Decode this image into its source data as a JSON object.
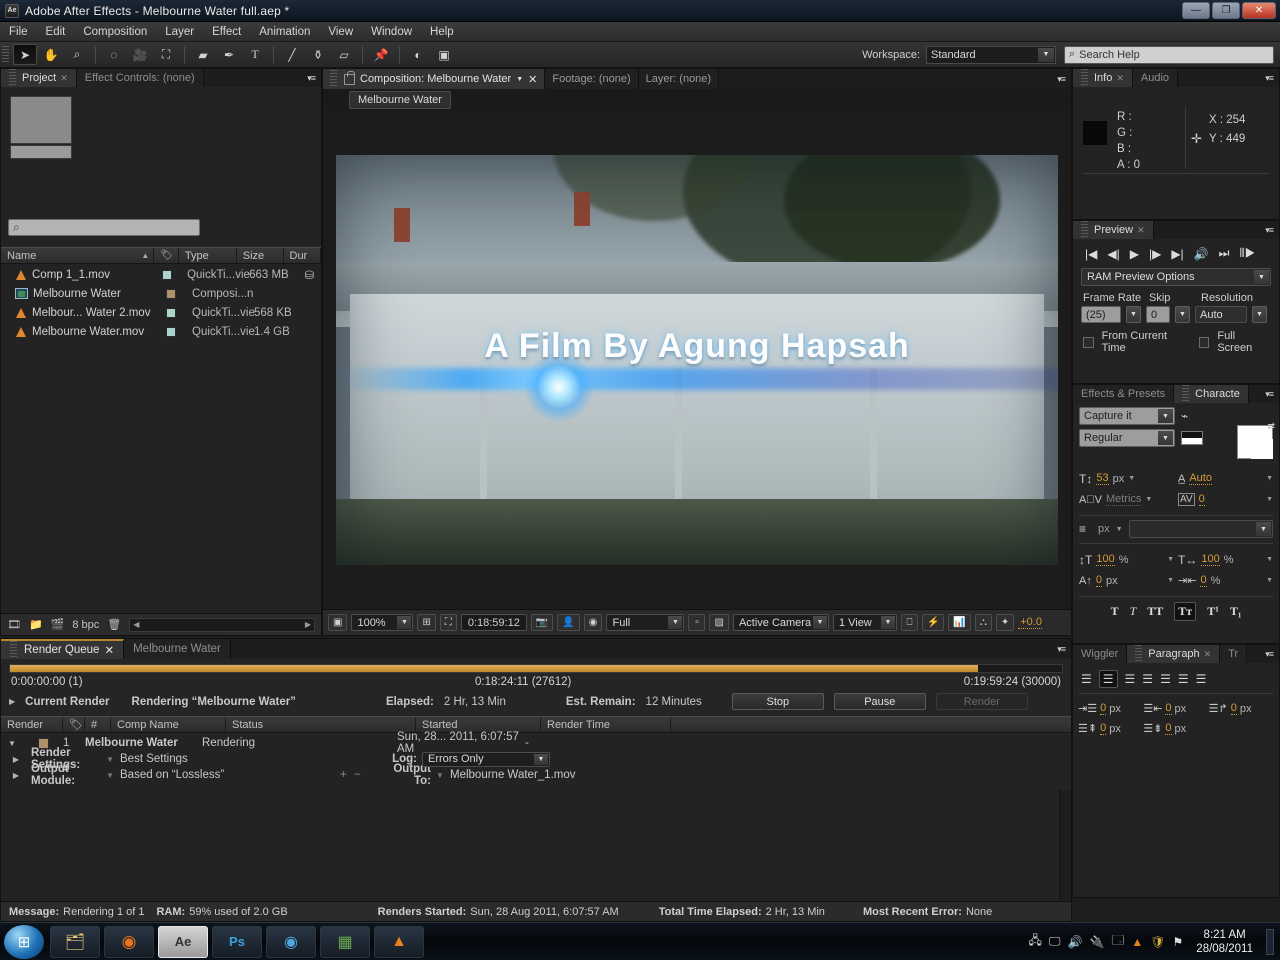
{
  "window": {
    "title": "Adobe After Effects - Melbourne Water full.aep *",
    "app_badge": "Ae",
    "minimize": "—",
    "maximize": "❐",
    "close": "✕"
  },
  "menubar": [
    "File",
    "Edit",
    "Composition",
    "Layer",
    "Effect",
    "Animation",
    "View",
    "Window",
    "Help"
  ],
  "toolbar": {
    "tools": [
      {
        "name": "selection-tool",
        "glyph": "➤"
      },
      {
        "name": "hand-tool",
        "glyph": "✋"
      },
      {
        "name": "zoom-tool",
        "glyph": "🔍"
      },
      {
        "name": "rotation-tool",
        "glyph": "⟳"
      },
      {
        "name": "camera-tool",
        "glyph": "🎥"
      },
      {
        "name": "anchor-point-tool",
        "glyph": "⛶"
      },
      {
        "name": "shape-tool",
        "glyph": "▢"
      },
      {
        "name": "pen-tool",
        "glyph": "✒"
      },
      {
        "name": "type-tool",
        "glyph": "T"
      },
      {
        "name": "brush-tool",
        "glyph": "🖌"
      },
      {
        "name": "clone-stamp-tool",
        "glyph": "⚒"
      },
      {
        "name": "eraser-tool",
        "glyph": "▱"
      },
      {
        "name": "puppet-pin-tool",
        "glyph": "📌"
      },
      {
        "name": "roto-brush-tool",
        "glyph": "◐"
      },
      {
        "name": "mask-tool",
        "glyph": "▣"
      }
    ],
    "workspace_label": "Workspace:",
    "workspace_value": "Standard",
    "search_placeholder": "Search Help",
    "search_icon": "search-icon"
  },
  "project_panel": {
    "tabs": [
      {
        "label": "Project",
        "active": true,
        "closable": true
      },
      {
        "label": "Effect Controls: (none)",
        "active": false,
        "closable": false
      }
    ],
    "search_placeholder": "",
    "search_icon": "search-icon",
    "columns": [
      "Name",
      "",
      "Type",
      "Size",
      "Dur"
    ],
    "items": [
      {
        "name": "Comp 1_1.mov",
        "icon": "movie-cone-icon",
        "label_color": "#a8d4cc",
        "type": "QuickTi...vie",
        "size": "663 MB"
      },
      {
        "name": "Melbourne Water",
        "icon": "composition-icon",
        "label_color": "#b09068",
        "type": "Composi...n",
        "size": ""
      },
      {
        "name": "Melbour... Water 2.mov",
        "icon": "movie-cone-icon",
        "label_color": "#a8d4cc",
        "type": "QuickTi...vie",
        "size": "568 KB"
      },
      {
        "name": "Melbourne Water.mov",
        "icon": "movie-cone-icon",
        "label_color": "#a8d4cc",
        "type": "QuickTi...vie",
        "size": "1.4 GB"
      }
    ],
    "footer": {
      "bit_depth": "8 bpc",
      "icons": [
        "new-comp-icon",
        "new-folder-icon",
        "interpret-footage-icon",
        "delete-icon"
      ]
    }
  },
  "comp_panel": {
    "tabs": [
      {
        "label": "Composition: Melbourne Water",
        "active": true
      },
      {
        "label": "Footage: (none)",
        "active": false
      },
      {
        "label": "Layer: (none)",
        "active": false
      }
    ],
    "comp_name_chip": "Melbourne Water",
    "viewer_title_line1": "A Film By Agung Hapsah",
    "footer": {
      "zoom": "100%",
      "time": "0:18:59:12",
      "resolution": "Full",
      "camera": "Active Camera",
      "views": "1 View",
      "exposure": "+0.0"
    }
  },
  "info_panel": {
    "tabs": [
      {
        "label": "Info",
        "active": true
      },
      {
        "label": "Audio",
        "active": false
      }
    ],
    "r": "R :",
    "g": "G :",
    "b": "B :",
    "a": "A : 0",
    "x": "X : 254",
    "y": "Y : 449"
  },
  "preview_panel": {
    "tabs": [
      {
        "label": "Preview",
        "active": true
      }
    ],
    "transport": [
      "first-frame-icon",
      "prev-frame-icon",
      "play-icon",
      "next-frame-icon",
      "last-frame-icon",
      "audio-icon",
      "ram-preview-icon",
      "loop-icon"
    ],
    "options_label": "RAM Preview Options",
    "frame_rate_label": "Frame Rate",
    "frame_rate_value": "(25)",
    "skip_label": "Skip",
    "skip_value": "0",
    "resolution_label": "Resolution",
    "resolution_value": "Auto",
    "from_current_time": "From Current Time",
    "full_screen": "Full Screen"
  },
  "character_panel": {
    "tabs": [
      {
        "label": "Effects & Presets",
        "active": false
      },
      {
        "label": "Characte",
        "active": true
      }
    ],
    "font_family": "Capture it",
    "font_style": "Regular",
    "font_size": "53",
    "font_size_unit": "px",
    "leading": "Auto",
    "kerning": "Metrics",
    "tracking": "0",
    "stroke_width": "",
    "stroke_width_unit": "px",
    "vertical_scale": "100",
    "horizontal_scale": "100",
    "baseline_shift": "0",
    "baseline_unit": "px",
    "tsume": "0",
    "tsume_unit": "%",
    "percent": "%",
    "style_buttons": [
      "T",
      "T",
      "TT",
      "Tᴛ",
      "T¹",
      "T₁"
    ]
  },
  "paragraph_panel": {
    "tabs": [
      {
        "label": "Wiggler",
        "active": false
      },
      {
        "label": "Paragraph",
        "active": true
      },
      {
        "label": "Tr",
        "active": false
      }
    ],
    "indents": [
      "0",
      "0",
      "0",
      "0",
      "0"
    ],
    "unit": "px"
  },
  "render_queue": {
    "tabs": [
      {
        "label": "Render Queue",
        "active": true,
        "closable": true
      },
      {
        "label": "Melbourne Water",
        "active": false,
        "closable": false
      }
    ],
    "progress_percent": 92,
    "time_start": "0:00:00:00 (1)",
    "time_current": "0:18:24:11 (27612)",
    "time_end": "0:19:59:24 (30000)",
    "current_render_label": "Current Render",
    "current_render_value": "Rendering “Melbourne Water”",
    "elapsed_label": "Elapsed:",
    "elapsed_value": "2 Hr, 13 Min",
    "est_remain_label": "Est. Remain:",
    "est_remain_value": "12 Minutes",
    "stop_button": "Stop",
    "pause_button": "Pause",
    "render_button": "Render",
    "columns": [
      "Render",
      "",
      "#",
      "Comp Name",
      "Status",
      "Started",
      "Render Time"
    ],
    "row": {
      "number": "1",
      "comp_name": "Melbourne Water",
      "status": "Rendering",
      "started": "Sun, 28... 2011, 6:07:57 AM",
      "render_time": "-"
    },
    "render_settings_label": "Render Settings:",
    "render_settings_value": "Best Settings",
    "log_label": "Log:",
    "log_value": "Errors Only",
    "output_module_label": "Output Module:",
    "output_module_value": "Based on “Lossless”",
    "output_to_label": "Output To:",
    "output_to_value": "Melbourne Water_1.mov",
    "status_bar": {
      "message_label": "Message:",
      "message_value": "Rendering 1 of 1",
      "ram_label": "RAM:",
      "ram_value": "59% used of 2.0 GB",
      "renders_started_label": "Renders Started:",
      "renders_started_value": "Sun, 28 Aug 2011, 6:07:57 AM",
      "total_elapsed_label": "Total Time Elapsed:",
      "total_elapsed_value": "2 Hr, 13 Min",
      "recent_error_label": "Most Recent Error:",
      "recent_error_value": "None"
    }
  },
  "taskbar": {
    "start_icon": "windows-start-icon",
    "items": [
      {
        "name": "windows-explorer-icon",
        "glyph": "🗂"
      },
      {
        "name": "firefox-icon",
        "glyph": "🦊"
      },
      {
        "name": "after-effects-icon",
        "glyph": "Ae"
      },
      {
        "name": "photoshop-icon",
        "glyph": "Ps"
      },
      {
        "name": "media-player-icon",
        "glyph": "◉"
      },
      {
        "name": "minecraft-icon",
        "glyph": "▦"
      },
      {
        "name": "vlc-icon",
        "glyph": "▲"
      }
    ],
    "tray_icons": [
      "network-error-icon",
      "display-icon",
      "volume-icon",
      "usb-icon",
      "update-icon",
      "vlc-tray-icon",
      "shield-icon",
      "flag-error-icon"
    ],
    "time": "8:21 AM",
    "date": "28/08/2011"
  },
  "colors": {
    "accent_orange": "#b8862a",
    "value_orange": "#d79b33",
    "panel_bg": "#232323",
    "title_blue": "#16202c"
  }
}
